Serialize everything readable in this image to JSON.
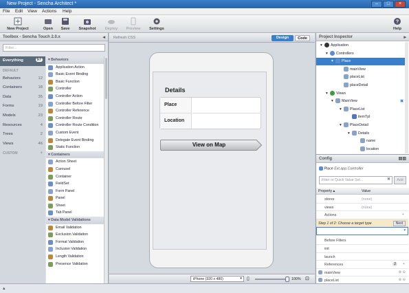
{
  "window": {
    "title": "New Project - Sencha Architect *"
  },
  "menu": [
    "File",
    "Edit",
    "View",
    "Actions",
    "Help"
  ],
  "toolbar": {
    "new_project": "New Project",
    "open": "Open",
    "save": "Save",
    "snapshot": "Snapshot",
    "deploy": "Deploy",
    "preview": "Preview",
    "settings": "Settings",
    "help": "Help"
  },
  "toolbox": {
    "title": "Toolbox - Sencha Touch 2.0.x",
    "filter_placeholder": "Filter...",
    "everything": {
      "label": "Everything",
      "count": "97"
    },
    "default_label": "DEFAULT",
    "categories": [
      {
        "label": "Behaviors",
        "count": "12"
      },
      {
        "label": "Containers",
        "count": "18"
      },
      {
        "label": "Data",
        "count": "35"
      },
      {
        "label": "Forms",
        "count": "19"
      },
      {
        "label": "Models",
        "count": "23"
      },
      {
        "label": "Resources",
        "count": "4"
      },
      {
        "label": "Trees",
        "count": "2"
      },
      {
        "label": "Views",
        "count": "46"
      }
    ],
    "custom_label": "CUSTOM",
    "groups": [
      {
        "name": "Behaviors",
        "items": [
          "Application Action",
          "Basic Event Binding",
          "Basic Function",
          "Controller",
          "Controller Action",
          "Controller Before Filter",
          "Controller Reference",
          "Controller Route",
          "Controller Route Condition",
          "Custom Event",
          "Delegate Event Binding",
          "Static Function"
        ]
      },
      {
        "name": "Containers",
        "items": [
          "Action Sheet",
          "Carousel",
          "Container",
          "FieldSet",
          "Form Panel",
          "Panel",
          "Sheet",
          "Tab Panel"
        ]
      },
      {
        "name": "Data Model Validations",
        "items": [
          "Email Validation",
          "Exclusion Validation",
          "Format Validation",
          "Inclusion Validation",
          "Length Validation",
          "Presence Validation"
        ]
      }
    ]
  },
  "canvas": {
    "refresh": "Refresh CSS",
    "design": "Design",
    "code": "Code",
    "form": {
      "title": "Details",
      "fields": [
        {
          "label": "Place"
        },
        {
          "label": "Location"
        }
      ],
      "button": "View on Map"
    },
    "device_select": "iPhone (320 x 480)",
    "zoom": "100%"
  },
  "inspector": {
    "title": "Project Inspector",
    "nodes": [
      "Application",
      "Controllers",
      "Place",
      "mainView",
      "placeList",
      "placeDetail",
      "Views",
      "MainView",
      "PlaceList",
      "itemTpl",
      "PlaceDetail",
      "Details",
      "name",
      "location"
    ]
  },
  "config": {
    "title": "Config",
    "subject": "Place",
    "subject_type": "Ext.app.Controller",
    "filter_placeholder": "Filter or Quick Value Set...",
    "add": "Add",
    "col_property": "Property",
    "col_value": "Value",
    "rows": [
      {
        "name": "stores",
        "value": "(none)"
      },
      {
        "name": "views",
        "value": "(none)"
      }
    ],
    "actions": "Actions",
    "step": "Step 1 of 2: Choose a target type",
    "next": "Next",
    "before_filters": "Before Filters",
    "filters": [
      "init",
      "launch"
    ],
    "references": "References",
    "references_count": "2",
    "refs": [
      "mainView",
      "placeList"
    ]
  }
}
